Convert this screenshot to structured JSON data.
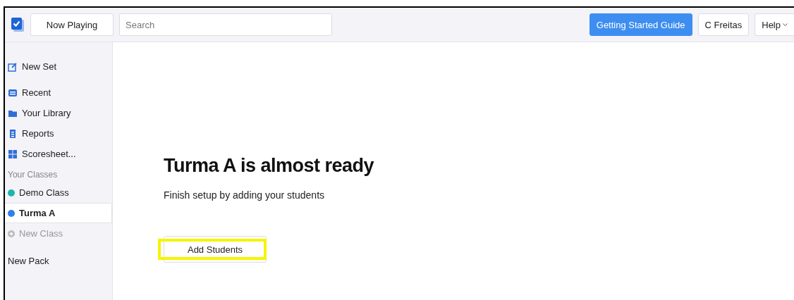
{
  "toolbar": {
    "now_playing": "Now Playing",
    "search": {
      "placeholder": "Search"
    },
    "guide_button": "Getting Started Guide",
    "user_button": "C Freitas",
    "help_button": "Help"
  },
  "sidebar": {
    "new_set": "New Set",
    "nav_items": [
      "Recent",
      "Your Library",
      "Reports",
      "Scoresheet..."
    ],
    "classes_heading": "Your Classes",
    "classes": [
      {
        "label": "Demo Class",
        "color": "#1fb5ac",
        "selected": false
      },
      {
        "label": "Turma A",
        "color": "#2f80ed",
        "selected": true
      }
    ],
    "new_class": {
      "label": "New Class",
      "disabled": true
    },
    "new_pack": "New Pack"
  },
  "main": {
    "title": "Turma A is almost ready",
    "subtitle": "Finish setup by adding your students",
    "button": {
      "label": "Add Students",
      "highlighted": true
    }
  }
}
